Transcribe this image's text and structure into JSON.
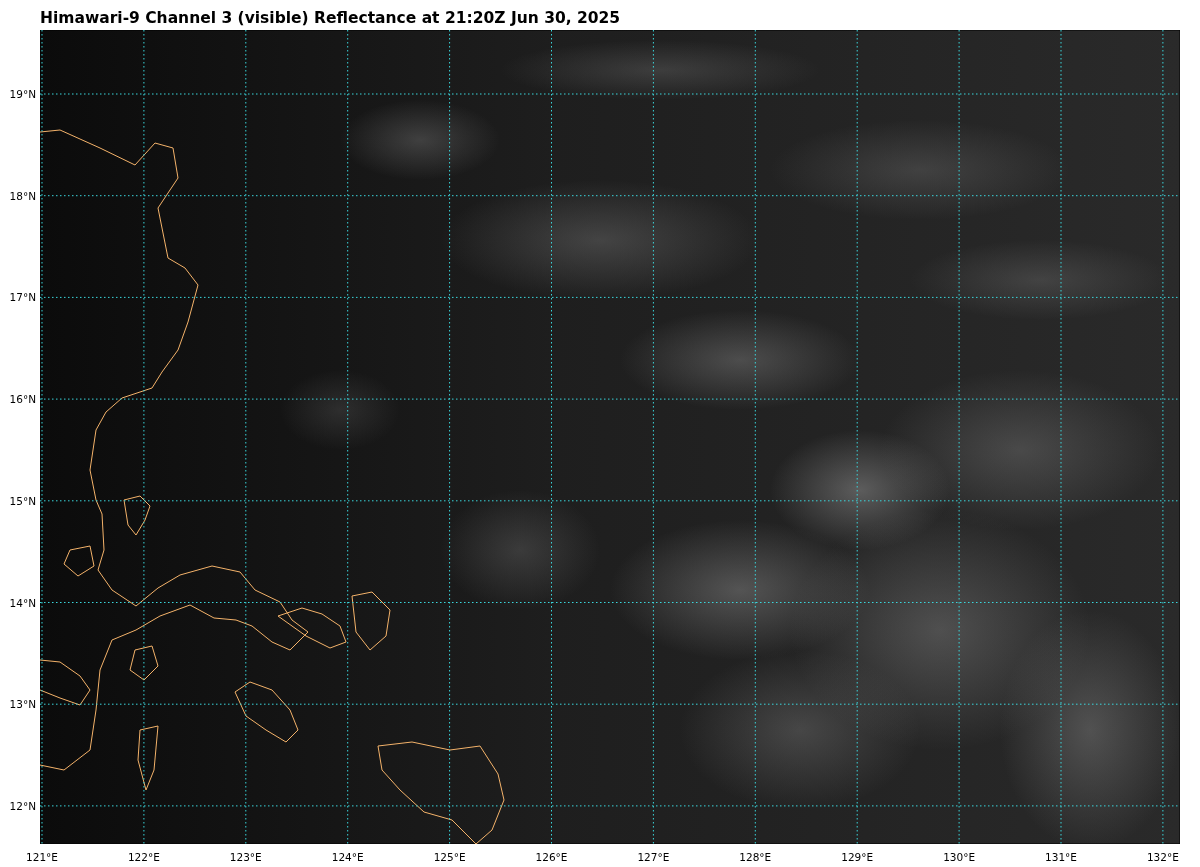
{
  "title": "Himawari-9 Channel 3 (visible) Reflectance at 21:20Z Jun 30, 2025",
  "map": {
    "longitude_labels": [
      "121°E",
      "122°E",
      "123°E",
      "124°E",
      "125°E",
      "126°E",
      "127°E",
      "128°E",
      "129°E",
      "130°E",
      "131°E",
      "132°E"
    ],
    "latitude_labels": [
      "19°N",
      "18°N",
      "17°N",
      "16°N",
      "15°N",
      "14°N",
      "13°N",
      "12°N"
    ]
  }
}
